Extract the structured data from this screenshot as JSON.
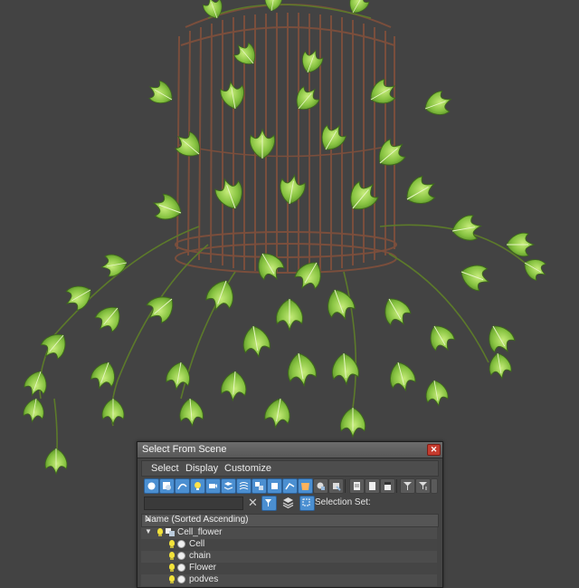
{
  "dialog": {
    "title": "Select From Scene",
    "close_glyph": "✕",
    "menu": [
      "Select",
      "Display",
      "Customize"
    ],
    "find_value": "",
    "clear_glyph": "✕",
    "selection_set_label": "Selection Set:",
    "column_header": "Name (Sorted Ascending)",
    "sort_glyph": "▲",
    "tree": [
      {
        "label": "Cell_flower",
        "expander": "▼",
        "level": 0
      },
      {
        "label": "Cell",
        "level": 1
      },
      {
        "label": "chain",
        "level": 1
      },
      {
        "label": "Flower",
        "level": 1
      },
      {
        "label": "podves",
        "level": 1
      }
    ]
  },
  "toolbar_icons": [
    "display-all-icon",
    "display-geometry-icon",
    "display-shapes-icon",
    "display-lights-icon",
    "display-cameras-icon",
    "display-helpers-icon",
    "display-spacewarps-icon",
    "display-groups-icon",
    "display-xrefs-icon",
    "display-bones-icon",
    "display-containers-icon",
    "display-frozen-icon",
    "select-all-icon",
    "select-none-icon",
    "select-invert-icon",
    "filter-icon",
    "hierarchy-icon",
    "layer-icon"
  ],
  "colors": {
    "viewport_bg": "#434343",
    "accent_blue": "#4b8fd1",
    "close_red": "#c43b2e",
    "bulb_yellow": "#f2e23a"
  }
}
